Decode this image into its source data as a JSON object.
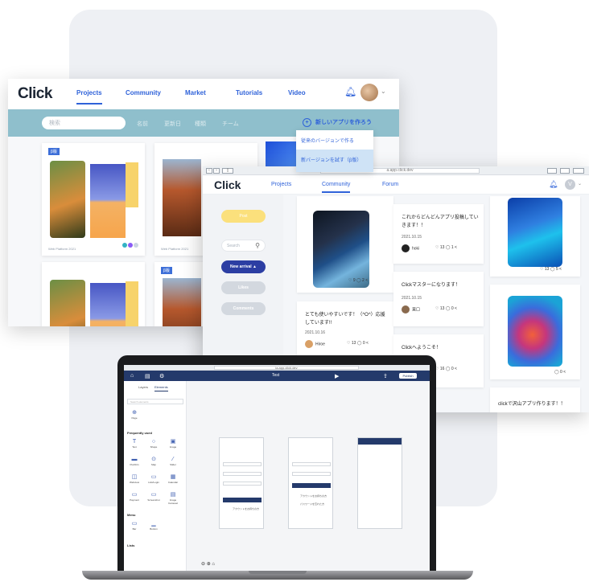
{
  "win1": {
    "logo": "Click",
    "nav": [
      "Projects",
      "Community",
      "Market",
      "Tutorials",
      "Video"
    ],
    "search_placeholder": "検索",
    "sort_options": [
      "名前",
      "更新日",
      "種類",
      "チーム"
    ],
    "new_app_label": "新しいアプリを作ろう",
    "dropdown": [
      "従来のバージョンで作る",
      "新バージョンを試す（β版）"
    ],
    "card_tag": "β版",
    "card_meta_1": "Web Platform 2021",
    "card_meta_2": "Web Platform 2021"
  },
  "win2": {
    "url": "a.app.click.dev",
    "logo": "Click",
    "nav": [
      "Projects",
      "Community",
      "Forum"
    ],
    "avatar_letter": "V",
    "sidebar": {
      "post": "Post",
      "search_placeholder": "Search",
      "new_arrival": "New arrival ▲",
      "likes": "Likes",
      "comments": "Comments"
    },
    "posts": [
      {
        "text": "これからどんどんアプリ投稿していきます！！",
        "date": "2021.10.15",
        "user": "hoki",
        "likes": "13",
        "comments": "1"
      },
      {
        "text": "Clickマスターになります！",
        "date": "2021.10.15",
        "user": "東口",
        "likes": "13",
        "comments": "0"
      },
      {
        "text": "とても使いやすいです！（^O^）応援しています!!",
        "date": "2021.10.16",
        "user": "Hiroe",
        "likes": "13",
        "comments": "0"
      },
      {
        "text": "Clickへようこそ！",
        "likes": "16",
        "comments": "0"
      },
      {
        "text": "clickで沢山アプリ作ります！！"
      }
    ],
    "img_stats": [
      {
        "likes": "9",
        "comments": "2"
      },
      {
        "likes": "13",
        "comments": "5"
      },
      {
        "likes": "",
        "comments": "0"
      }
    ]
  },
  "laptop": {
    "url": "ia.app.click.dev",
    "title": "Test",
    "publish": "Publish",
    "tabs": [
      "Layers",
      "Elements"
    ],
    "search_placeholder": "Search elements",
    "page_label": "Page",
    "sections": [
      "Frequently used",
      "Menu",
      "Lists"
    ],
    "elements": [
      "Text",
      "Shape",
      "Image",
      "Pushbtn",
      "Map",
      "Slider",
      "Webview",
      "Link/Login",
      "Calendar",
      "Payment",
      "Screenshot",
      "Image Carousel",
      "Bar",
      "Bottom"
    ],
    "screen_texts": [
      "アカウントをお持ちの方",
      "パスワードを忘れた方"
    ]
  },
  "colors": {
    "accent": "#2f62d9",
    "filter_bar": "#8fbfcc",
    "editor_dark": "#243a6b"
  }
}
